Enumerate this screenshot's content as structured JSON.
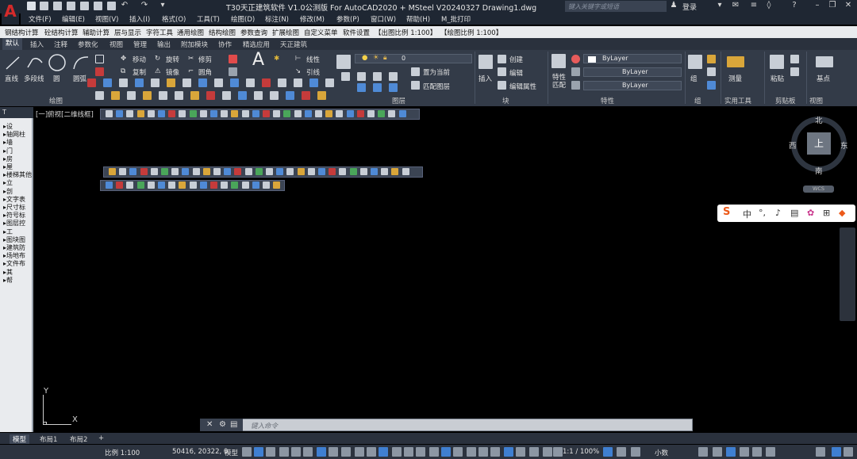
{
  "app": {
    "title": "T30天正建筑软件 V1.0公测版 For AutoCAD2020 + MSteel V20240327    Drawing1.dwg",
    "logo": "A",
    "search_placeholder": "键入关键字或短语",
    "login_label": "登录"
  },
  "menu": [
    "文件(F)",
    "编辑(E)",
    "视图(V)",
    "插入(I)",
    "格式(O)",
    "工具(T)",
    "绘图(D)",
    "标注(N)",
    "修改(M)",
    "参数(P)",
    "窗口(W)",
    "帮助(H)",
    "M_批打印"
  ],
  "tz_menu": [
    "钢结构计算",
    "砼结构计算",
    "辅助计算",
    "层与显示",
    "字符工具",
    "通用绘图",
    "结构绘图",
    "参数查询",
    "扩展绘图",
    "自定义菜单",
    "软件设置",
    "【出图比例 1:100】",
    "【绘图比例 1:100】"
  ],
  "ribbon_tabs": [
    "默认",
    "插入",
    "注释",
    "参数化",
    "视图",
    "管理",
    "输出",
    "附加模块",
    "协作",
    "精选应用",
    "天正建筑"
  ],
  "ribbon": {
    "draw": {
      "line": "直线",
      "polyline": "多段线",
      "circle": "圆",
      "arc": "圆弧",
      "group": "绘图"
    },
    "modify": {
      "move": "移动",
      "rotate": "旋转",
      "trim": "修剪",
      "copy": "复制",
      "mirror": "镜像",
      "fillet": "圆角"
    },
    "annotation": {
      "linear": "线性",
      "leader": "引线"
    },
    "layer": {
      "current": "0",
      "set_current": "置为当前",
      "match_layer": "匹配图层",
      "group": "图层"
    },
    "block": {
      "insert": "插入",
      "create": "创建",
      "edit": "编辑",
      "edit_attr": "编辑属性",
      "group": "块"
    },
    "properties": {
      "match": "特性\n匹配",
      "color": "ByLayer",
      "linetype": "ByLayer",
      "lineweight": "ByLayer",
      "group": "特性"
    },
    "groups": {
      "group": "组",
      "utilities": "实用工具",
      "measure": "测量",
      "clipboard": "剪贴板",
      "paste": "粘贴",
      "view": "视图",
      "basepoint": "基点"
    }
  },
  "palette": {
    "header": "T",
    "items": [
      "设",
      "轴网柱",
      "墙",
      "门",
      "房",
      "屋",
      "楼梯其他",
      "立",
      "剖",
      "文字表",
      "尺寸标",
      "符号标",
      "图层控",
      "工",
      "图块图",
      "建筑防",
      "场地布",
      "文件布",
      "其",
      "帮"
    ]
  },
  "viewport": {
    "label": "[一]俯视[二维线框]",
    "x_axis": "X",
    "y_axis": "Y"
  },
  "viewcube": {
    "north": "北",
    "south": "南",
    "east": "东",
    "west": "西",
    "top": "上",
    "wcs": "WCS"
  },
  "ime": {
    "mode": "中"
  },
  "command": {
    "placeholder": "键入命令"
  },
  "layouts": [
    "模型",
    "布局1",
    "布局2"
  ],
  "status": {
    "scale": "比例 1:100",
    "coords": "50416, 20322, 0",
    "model": "模型",
    "annoscale": "1:1 / 100%",
    "units": "小数"
  }
}
